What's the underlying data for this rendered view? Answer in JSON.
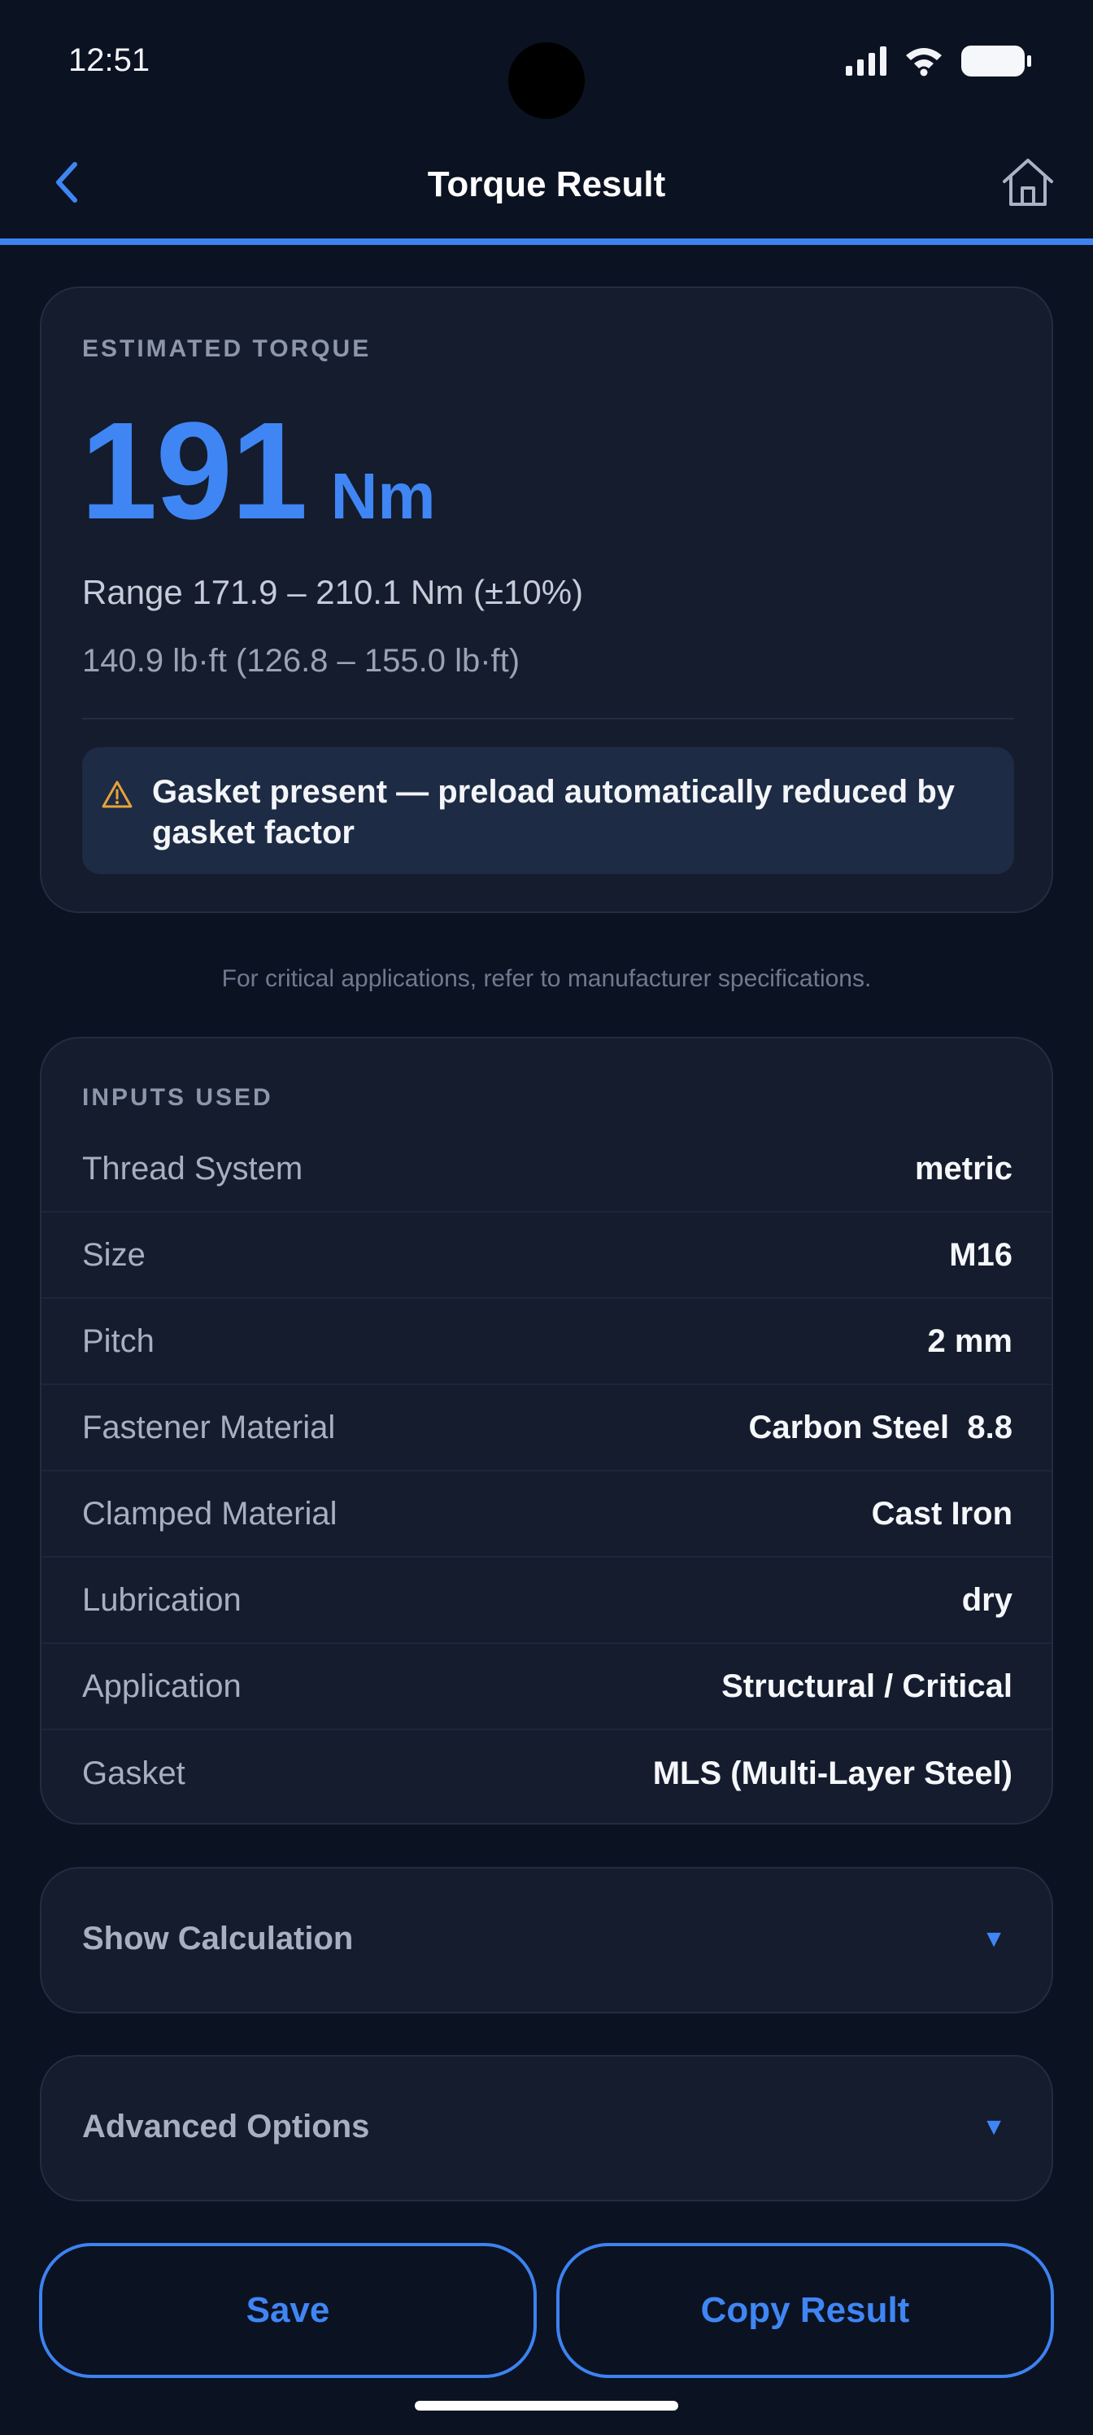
{
  "status_bar": {
    "time": "12:51"
  },
  "app_bar": {
    "title": "Torque Result",
    "back_icon": "chevron-left-icon",
    "home_icon": "home-icon"
  },
  "result": {
    "label": "ESTIMATED TORQUE",
    "value": "191",
    "unit": "Nm",
    "range_text": "Range  171.9 – 210.1 Nm  (±10%)",
    "imperial_text": "140.9 lb·ft  (126.8 – 155.0 lb·ft)",
    "notice": {
      "icon": "warning-icon",
      "text": "Gasket present — preload automatically reduced by gasket factor"
    }
  },
  "disclaimer": "For critical applications, refer to manufacturer specifications.",
  "inputs": {
    "label": "INPUTS USED",
    "rows": [
      {
        "label": "Thread System",
        "value": "metric"
      },
      {
        "label": "Size",
        "value": "M16"
      },
      {
        "label": "Pitch",
        "value": "2 mm"
      },
      {
        "label": "Fastener Material",
        "value": "Carbon Steel  8.8"
      },
      {
        "label": "Clamped Material",
        "value": "Cast Iron"
      },
      {
        "label": "Lubrication",
        "value": "dry"
      },
      {
        "label": "Application",
        "value": "Structural / Critical"
      },
      {
        "label": "Gasket",
        "value": "MLS (Multi-Layer Steel)"
      }
    ]
  },
  "expanders": {
    "calculation": {
      "label": "Show Calculation",
      "arrow": "▼"
    },
    "advanced": {
      "label": "Advanced Options",
      "arrow": "▼"
    }
  },
  "actions": {
    "save_label": "Save",
    "copy_label": "Copy Result"
  },
  "colors": {
    "accent": "#3d82f0",
    "background": "#0b1222",
    "card": "#141c2d",
    "warning": "#e6a23c"
  }
}
